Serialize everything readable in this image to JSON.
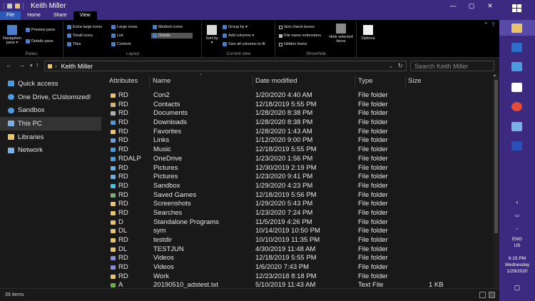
{
  "window": {
    "title": "Keith Miller",
    "controls": {
      "minimize": "—",
      "maximize": "▢",
      "close": "✕"
    }
  },
  "ribbon_tabs": [
    "File",
    "Home",
    "Share",
    "View"
  ],
  "ribbon": {
    "panes": {
      "navigation_pane": "Navigation pane ▾",
      "preview_pane": "Preview pane",
      "details_pane": "Details pane",
      "label": "Panes"
    },
    "layout": {
      "items": [
        "Extra large icons",
        "Large icons",
        "Medium icons",
        "Small icons",
        "List",
        "Details",
        "Tiles",
        "Content"
      ],
      "selected": "Details",
      "label": "Layout"
    },
    "current_view": {
      "sort_by": "Sort by ▾",
      "group_by": "Group by ▾",
      "add_columns": "Add columns ▾",
      "size_all_columns": "Size all columns to fit",
      "label": "Current view"
    },
    "show_hide": {
      "item_check_boxes": "Item check boxes",
      "file_name_extensions": "File name extensions",
      "hidden_items": "Hidden items",
      "hide_selected_items": "Hide selected items",
      "label": "Show/hide"
    },
    "options": "Options"
  },
  "address": {
    "path": "Keith Miller",
    "search_placeholder": "Search Keith Miller"
  },
  "nav_pane": [
    {
      "label": "Quick access",
      "icon": "star-icon",
      "color": "#4b9be0"
    },
    {
      "label": "One Drive, CUstomized!",
      "icon": "cloud-icon",
      "color": "#4b9be0"
    },
    {
      "label": "Sandbox",
      "icon": "cloud-icon",
      "color": "#4b9be0"
    },
    {
      "label": "This PC",
      "icon": "computer-icon",
      "color": "#7ab0e8",
      "selected": true
    },
    {
      "label": "Libraries",
      "icon": "library-icon",
      "color": "#e8c46a"
    },
    {
      "label": "Network",
      "icon": "network-icon",
      "color": "#7ab0e8"
    }
  ],
  "columns": {
    "attributes": "Attributes",
    "name": "Name",
    "date_modified": "Date modified",
    "type": "Type",
    "size": "Size"
  },
  "files": [
    {
      "attr": "RD",
      "name": "Con2",
      "date": "1/20/2020 4:40 AM",
      "type": "File folder",
      "size": "",
      "icon_color": "#e8c46a"
    },
    {
      "attr": "RD",
      "name": "Contacts",
      "date": "12/18/2019 5:55 PM",
      "type": "File folder",
      "size": "",
      "icon_color": "#d8b870"
    },
    {
      "attr": "RD",
      "name": "Documents",
      "date": "1/28/2020 8:38 PM",
      "type": "File folder",
      "size": "",
      "icon_color": "#b0b0b0"
    },
    {
      "attr": "RD",
      "name": "Downloads",
      "date": "1/28/2020 8:38 PM",
      "type": "File folder",
      "size": "",
      "icon_color": "#4b9be0"
    },
    {
      "attr": "RD",
      "name": "Favorites",
      "date": "1/28/2020 1:43 AM",
      "type": "File folder",
      "size": "",
      "icon_color": "#e8c46a"
    },
    {
      "attr": "RD",
      "name": "Links",
      "date": "1/12/2020 9:00 PM",
      "type": "File folder",
      "size": "",
      "icon_color": "#6a9fd8"
    },
    {
      "attr": "RD",
      "name": "Music",
      "date": "12/18/2019 5:55 PM",
      "type": "File folder",
      "size": "",
      "icon_color": "#4b9be0"
    },
    {
      "attr": "RDALP",
      "name": "OneDrive",
      "date": "1/23/2020 1:56 PM",
      "type": "File folder",
      "size": "",
      "icon_color": "#4b9be0"
    },
    {
      "attr": "RD",
      "name": "Pictures",
      "date": "12/30/2019 2:19 PM",
      "type": "File folder",
      "size": "",
      "icon_color": "#6ab0e0"
    },
    {
      "attr": "RD",
      "name": "Pictures",
      "date": "1/23/2020 9:41 PM",
      "type": "File folder",
      "size": "",
      "icon_color": "#6ab0e0"
    },
    {
      "attr": "RD",
      "name": "Sandbox",
      "date": "1/29/2020 4:23 PM",
      "type": "File folder",
      "size": "",
      "icon_color": "#4bc0e0"
    },
    {
      "attr": "RD",
      "name": "Saved Games",
      "date": "12/18/2019 5:56 PM",
      "type": "File folder",
      "size": "",
      "icon_color": "#7ab07a"
    },
    {
      "attr": "RD",
      "name": "Screenshots",
      "date": "1/29/2020 5:43 PM",
      "type": "File folder",
      "size": "",
      "icon_color": "#e8c46a"
    },
    {
      "attr": "RD",
      "name": "Searches",
      "date": "1/23/2020 7:24 PM",
      "type": "File folder",
      "size": "",
      "icon_color": "#e8c46a"
    },
    {
      "attr": "D",
      "name": "Standalone Programs",
      "date": "11/5/2019 4:26 PM",
      "type": "File folder",
      "size": "",
      "icon_color": "#e8c46a"
    },
    {
      "attr": "DL",
      "name": "sym",
      "date": "10/14/2019 10:50 PM",
      "type": "File folder",
      "size": "",
      "icon_color": "#e8c46a"
    },
    {
      "attr": "RD",
      "name": "testdir",
      "date": "10/10/2019 11:35 PM",
      "type": "File folder",
      "size": "",
      "icon_color": "#e8c46a"
    },
    {
      "attr": "DL",
      "name": "TESTJUN",
      "date": "4/30/2019 11:48 AM",
      "type": "File folder",
      "size": "",
      "icon_color": "#e8c46a"
    },
    {
      "attr": "RD",
      "name": "Videos",
      "date": "12/18/2019 5:55 PM",
      "type": "File folder",
      "size": "",
      "icon_color": "#8a8ad8"
    },
    {
      "attr": "RD",
      "name": "Videos",
      "date": "1/6/2020 7:43 PM",
      "type": "File folder",
      "size": "",
      "icon_color": "#8a8ad8"
    },
    {
      "attr": "RD",
      "name": "Work",
      "date": "12/23/2018 8:18 PM",
      "type": "File folder",
      "size": "",
      "icon_color": "#e8c46a"
    },
    {
      "attr": "A",
      "name": "20190510_adstest.txt",
      "date": "5/10/2019 11:43 AM",
      "type": "Text File",
      "size": "1 KB",
      "icon_color": "#6ab04b"
    }
  ],
  "status": {
    "item_count": "39 items"
  },
  "taskbar": {
    "tray": {
      "language": "ENG",
      "region": "US",
      "time": "6:15 PM",
      "day": "Wednesday",
      "date": "1/29/2020"
    }
  }
}
